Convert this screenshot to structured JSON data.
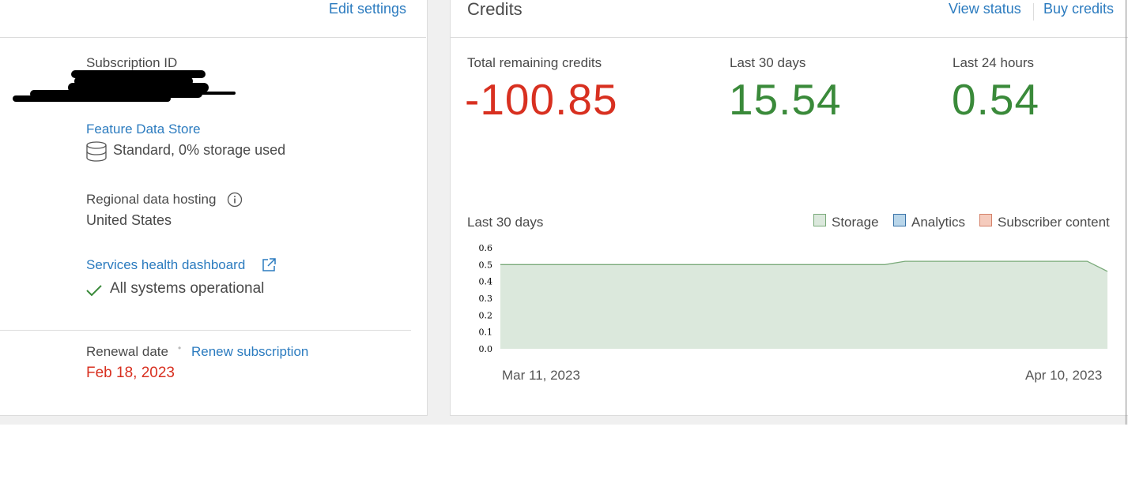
{
  "subscription": {
    "edit_settings": "Edit settings",
    "id_label": "Subscription ID",
    "feature_store_link": "Feature Data Store",
    "storage_text": "Standard, 0% storage used",
    "regional_label": "Regional data hosting",
    "regional_value": "United States",
    "health_link": "Services health dashboard",
    "health_status": "All systems operational",
    "renewal_label": "Renewal date",
    "renewal_separator": "•",
    "renew_link": "Renew subscription",
    "renewal_date": "Feb 18, 2023"
  },
  "credits": {
    "title": "Credits",
    "view_status": "View status",
    "buy_credits": "Buy credits",
    "stats": [
      {
        "label": "Total remaining credits",
        "value": "-100.85"
      },
      {
        "label": "Last 30 days",
        "value": "15.54"
      },
      {
        "label": "Last 24 hours",
        "value": "0.54"
      }
    ],
    "colors": {
      "negative": "#d83020",
      "positive": "#3a8a3a",
      "link": "#2b7bbf"
    }
  },
  "chart_data": {
    "type": "area",
    "title": "Last 30 days",
    "legend": [
      {
        "name": "Storage",
        "fill": "#dbe8dc",
        "stroke": "#7aaa7a"
      },
      {
        "name": "Analytics",
        "fill": "#b9d6ea",
        "stroke": "#3a73a8"
      },
      {
        "name": "Subscriber content",
        "fill": "#f5cbbd",
        "stroke": "#d4826a"
      }
    ],
    "legend_placement": "top-right",
    "y_ticks": [
      "0.0",
      "0.1",
      "0.2",
      "0.3",
      "0.4",
      "0.5",
      "0.6"
    ],
    "ylim": [
      0,
      0.6
    ],
    "x_labels": [
      "Mar 11, 2023",
      "Apr 10, 2023"
    ],
    "series": [
      {
        "name": "Storage",
        "x": [
          "Mar 11",
          "Mar 12",
          "Mar 13",
          "Mar 14",
          "Mar 15",
          "Mar 16",
          "Mar 17",
          "Mar 18",
          "Mar 19",
          "Mar 20",
          "Mar 21",
          "Mar 22",
          "Mar 23",
          "Mar 24",
          "Mar 25",
          "Mar 26",
          "Mar 27",
          "Mar 28",
          "Mar 29",
          "Mar 30",
          "Mar 31",
          "Apr 1",
          "Apr 2",
          "Apr 3",
          "Apr 4",
          "Apr 5",
          "Apr 6",
          "Apr 7",
          "Apr 8",
          "Apr 9",
          "Apr 10"
        ],
        "values": [
          0.5,
          0.5,
          0.5,
          0.5,
          0.5,
          0.5,
          0.5,
          0.5,
          0.5,
          0.5,
          0.5,
          0.5,
          0.5,
          0.5,
          0.5,
          0.5,
          0.5,
          0.5,
          0.5,
          0.5,
          0.52,
          0.52,
          0.52,
          0.52,
          0.52,
          0.52,
          0.52,
          0.52,
          0.52,
          0.52,
          0.46
        ]
      }
    ]
  }
}
